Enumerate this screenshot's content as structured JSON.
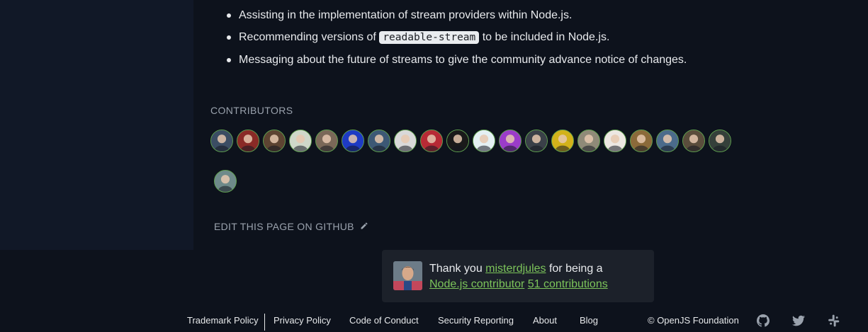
{
  "content": {
    "bullets": [
      {
        "text": "Assisting in the implementation of stream providers within Node.js."
      },
      {
        "before": "Recommending versions of ",
        "code": "readable-stream",
        "after": " to be included in Node.js."
      },
      {
        "text": "Messaging about the future of streams to give the community advance notice of changes."
      }
    ]
  },
  "contributors": {
    "title": "CONTRIBUTORS",
    "avatar_colors": [
      "#3b4d63",
      "#8a2a26",
      "#5d4432",
      "#cfd8c9",
      "#7a6858",
      "#1e3bc4",
      "#3c5875",
      "#d9d9d9",
      "#b72a35",
      "#1a1a1a",
      "#e4f0f3",
      "#9b3cc9",
      "#3a4048",
      "#d2b21b",
      "#8f8a78",
      "#ece7e2",
      "#8b6a3a",
      "#4b6b8b",
      "#5a4d3c",
      "#35403a",
      "#6e8a8a"
    ]
  },
  "edit": {
    "label": "EDIT THIS PAGE ON GITHUB",
    "icon": "pencil-icon"
  },
  "thanks": {
    "prefix": "Thank you ",
    "user": "misterdjules",
    "middle": " for being a",
    "role": "Node.js contributor",
    "count": "51 contributions"
  },
  "footer": {
    "links": [
      "Trademark Policy",
      "Privacy Policy",
      "Code of Conduct",
      "Security Reporting",
      "About",
      "Blog"
    ],
    "copyright": "© OpenJS Foundation",
    "social": [
      "github-icon",
      "twitter-icon",
      "slack-icon"
    ]
  }
}
